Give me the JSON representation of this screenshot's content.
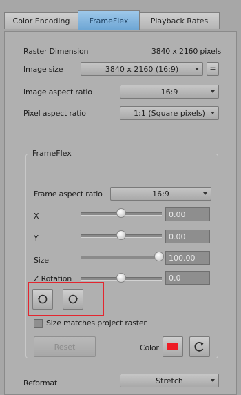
{
  "tabs": [
    {
      "label": "Color Encoding",
      "active": false
    },
    {
      "label": "FrameFlex",
      "active": true
    },
    {
      "label": "Playback Rates",
      "active": false
    }
  ],
  "raster": {
    "label": "Raster Dimension",
    "value": "3840 x 2160 pixels"
  },
  "image_size": {
    "label": "Image size",
    "value": "3840 x 2160 (16:9)",
    "button": "="
  },
  "image_aspect": {
    "label": "Image aspect ratio",
    "value": "16:9"
  },
  "pixel_aspect": {
    "label": "Pixel aspect ratio",
    "value": "1:1 (Square pixels)"
  },
  "frameflex": {
    "title": "FrameFlex",
    "frame_aspect": {
      "label": "Frame aspect ratio",
      "value": "16:9"
    },
    "x": {
      "label": "X",
      "value": "0.00",
      "slider": 0.5
    },
    "y": {
      "label": "Y",
      "value": "0.00",
      "slider": 0.5
    },
    "size": {
      "label": "Size",
      "value": "100.00",
      "slider": 1.0
    },
    "z_rotation": {
      "label": "Z Rotation",
      "value": "0.0",
      "slider": 0.5
    },
    "size_matches": {
      "label": "Size matches project raster",
      "checked": false
    },
    "reset_label": "Reset",
    "color_label": "Color",
    "color_swatch": "#ee1c25"
  },
  "reformat": {
    "label": "Reformat",
    "value": "Stretch"
  },
  "colors": {
    "highlight": "#e3262f",
    "active_tab": "#6ea6d4"
  }
}
